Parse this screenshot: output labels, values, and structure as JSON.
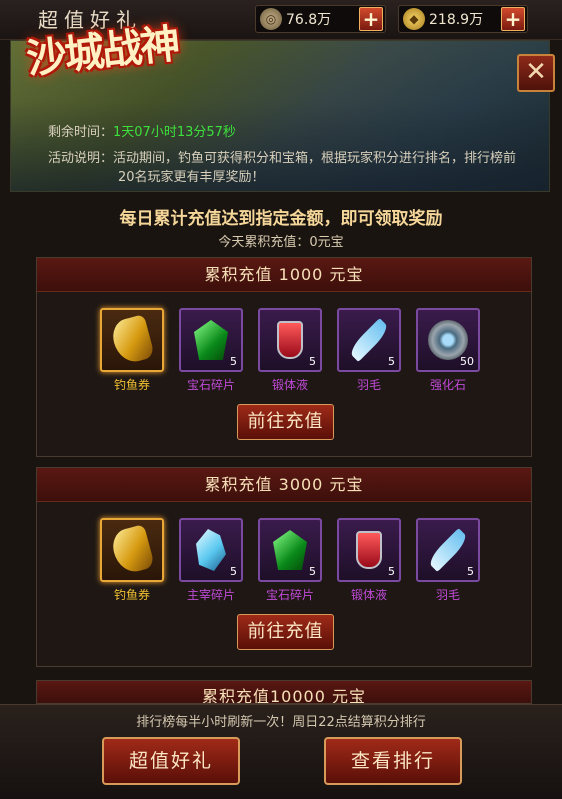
{
  "header": {
    "title": "超值好礼",
    "currency_a": {
      "value": "76.8万",
      "icon": "coin-icon"
    },
    "currency_b": {
      "value": "218.9万",
      "icon": "gold-ingot-icon"
    },
    "plus": "+"
  },
  "banner": {
    "logo_text": "沙城战神",
    "close": "✕",
    "remaining_label": "剩余时间：",
    "remaining_value": "1天07小时13分57秒",
    "desc_label": "活动说明：",
    "desc_text": "活动期间，钓鱼可获得积分和宝箱，根据玩家积分进行排名，排行榜前20名玩家更有丰厚奖励！"
  },
  "headline": "每日累计充值达到指定金额，即可领取奖励",
  "today_recharge": "今天累积充值：0元宝",
  "tiers": [
    {
      "title": "累积充值 1000 元宝",
      "button": "前往充值",
      "items": [
        {
          "name": "钓鱼券",
          "count": "",
          "icon": "fishing-ticket-icon",
          "rarity": "gold"
        },
        {
          "name": "宝石碎片",
          "count": "5",
          "icon": "green-gem-icon",
          "rarity": "purple"
        },
        {
          "name": "锻体液",
          "count": "5",
          "icon": "potion-icon",
          "rarity": "purple"
        },
        {
          "name": "羽毛",
          "count": "5",
          "icon": "feather-icon",
          "rarity": "purple"
        },
        {
          "name": "强化石",
          "count": "50",
          "icon": "enhance-stone-icon",
          "rarity": "purple"
        }
      ]
    },
    {
      "title": "累积充值 3000 元宝",
      "button": "前往充值",
      "items": [
        {
          "name": "钓鱼券",
          "count": "",
          "icon": "fishing-ticket-icon",
          "rarity": "gold"
        },
        {
          "name": "主宰碎片",
          "count": "5",
          "icon": "blue-crystal-icon",
          "rarity": "purple"
        },
        {
          "name": "宝石碎片",
          "count": "5",
          "icon": "green-gem-icon",
          "rarity": "purple"
        },
        {
          "name": "锻体液",
          "count": "5",
          "icon": "potion-icon",
          "rarity": "purple"
        },
        {
          "name": "羽毛",
          "count": "5",
          "icon": "feather-icon",
          "rarity": "purple"
        }
      ]
    },
    {
      "title": "累积充值10000 元宝"
    }
  ],
  "footer": {
    "notice": "排行榜每半小时刷新一次！周日22点结算积分排行",
    "btn_gift": "超值好礼",
    "btn_rank": "查看排行"
  },
  "colors": {
    "accent_red": "#9e2a18",
    "gold_text": "#f6d79a",
    "green_text": "#3de03d",
    "purple_text": "#c04ad8"
  }
}
